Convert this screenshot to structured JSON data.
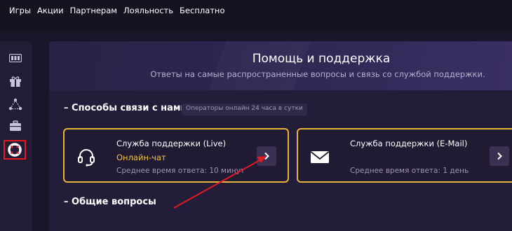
{
  "nav": {
    "items": [
      "Игры",
      "Акции",
      "Партнерам",
      "Лояльность",
      "Бесплатно"
    ]
  },
  "sidebar": {
    "icons": [
      "slots-icon",
      "gift-icon",
      "network-icon",
      "briefcase-icon",
      "lifebuoy-icon"
    ],
    "active": "lifebuoy-icon"
  },
  "hero": {
    "title": "Помощь и поддержка",
    "subtitle": "Ответы на самые распространенные вопросы и связь со службой поддержки."
  },
  "contact": {
    "title": "– Способы связи с нами",
    "badge": "Операторы онлайн 24 часа в сутки",
    "cards": [
      {
        "title": "Служба поддержки (Live)",
        "link": "Онлайн-чат",
        "time": "Среднее время ответа: 10 минут",
        "icon": "headset-icon"
      },
      {
        "title": "Служба поддержки (E-Mail)",
        "link": "",
        "time": "Среднее время ответа: 1 день",
        "icon": "envelope-icon"
      }
    ]
  },
  "faq": {
    "title": "– Общие вопросы"
  },
  "colors": {
    "background": "#1a1528",
    "panel": "#241d3a",
    "accent": "#e6b43a",
    "link": "#f3c43f",
    "highlight": "#e01b24"
  }
}
